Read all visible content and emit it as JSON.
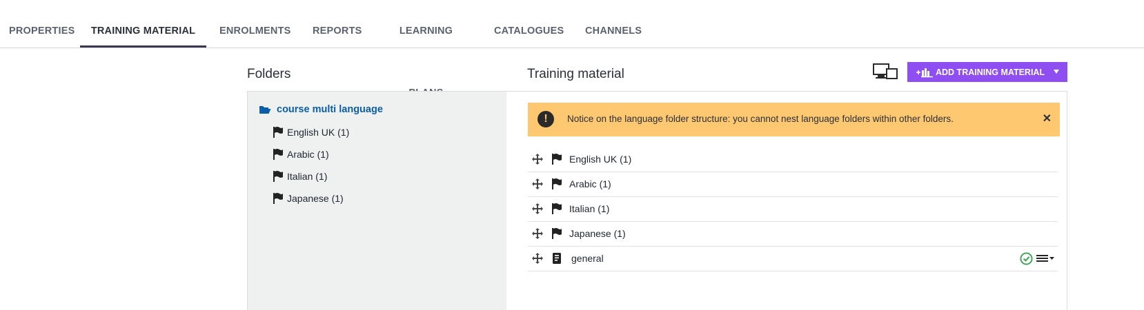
{
  "tabs": [
    {
      "label": "PROPERTIES",
      "active": false
    },
    {
      "label": "TRAINING MATERIAL",
      "active": true
    },
    {
      "label": "ENROLMENTS",
      "active": false
    },
    {
      "label": "REPORTS",
      "active": false
    },
    {
      "label": "LEARNING PLANS",
      "active": false
    },
    {
      "label": "CATALOGUES",
      "active": false
    },
    {
      "label": "CHANNELS",
      "active": false
    }
  ],
  "folders": {
    "heading": "Folders",
    "root": {
      "label": "course multi language",
      "icon": "folder-open-icon"
    },
    "items": [
      {
        "label": "English UK (1)",
        "icon": "flag-icon"
      },
      {
        "label": "Arabic (1)",
        "icon": "flag-icon"
      },
      {
        "label": "Italian (1)",
        "icon": "flag-icon"
      },
      {
        "label": "Japanese (1)",
        "icon": "flag-icon"
      }
    ]
  },
  "training": {
    "heading": "Training material",
    "add_button_label": "ADD TRAINING MATERIAL",
    "notice": "Notice on the language folder structure: you cannot nest language folders within other folders.",
    "rows": [
      {
        "label": "English UK (1)",
        "icon": "flag-icon"
      },
      {
        "label": "Arabic (1)",
        "icon": "flag-icon"
      },
      {
        "label": "Italian (1)",
        "icon": "flag-icon"
      },
      {
        "label": "Japanese (1)",
        "icon": "flag-icon"
      },
      {
        "label": "general",
        "icon": "document-icon",
        "status": "published"
      }
    ]
  },
  "colors": {
    "accent": "#8f4ef2",
    "notice_bg": "#fdc870",
    "link": "#0a5ea8",
    "success": "#3aa655"
  }
}
